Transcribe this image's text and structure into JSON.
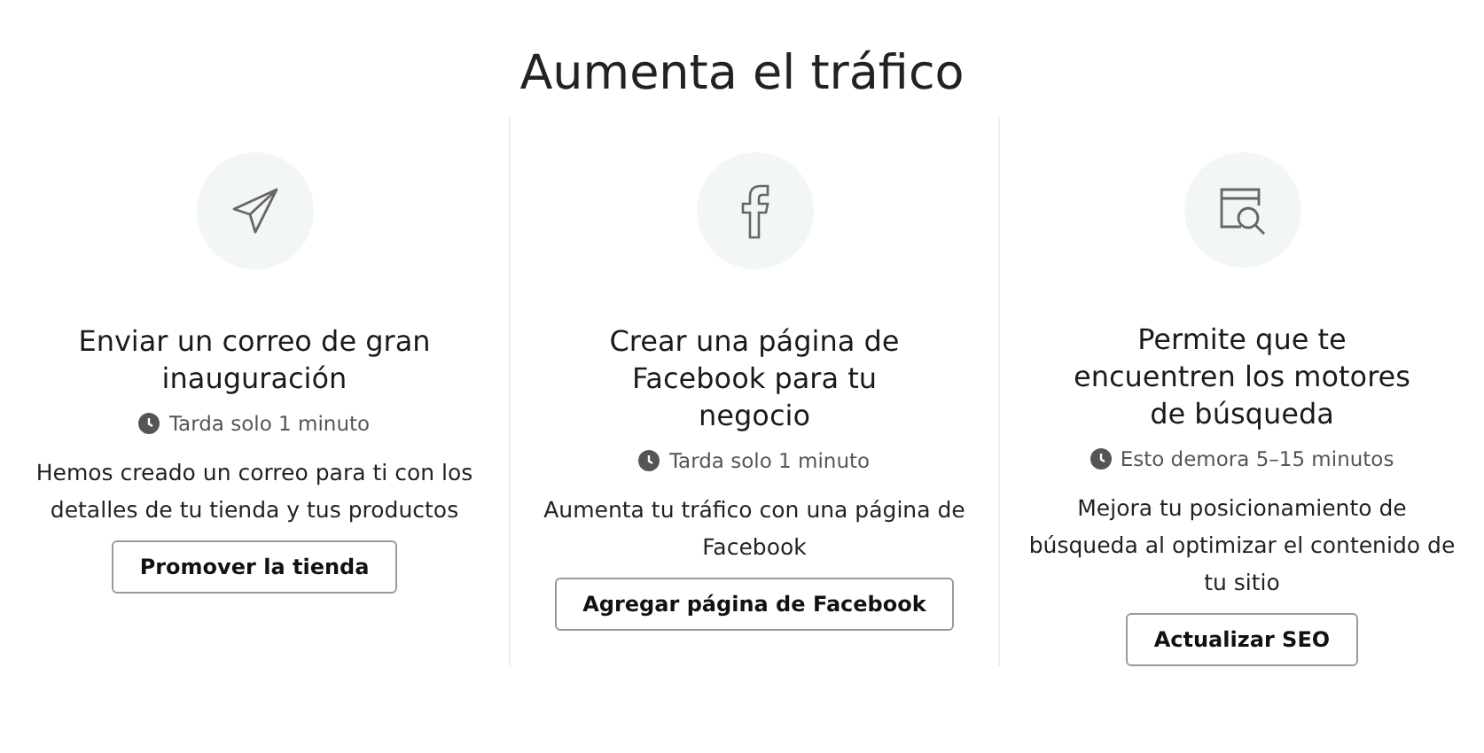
{
  "heading": "Aumenta el tráfico",
  "cards": [
    {
      "kind": "plane",
      "title": "Enviar un correo de gran inauguración",
      "time": "Tarda solo 1 minuto",
      "description": "Hemos creado un correo para ti con los detalles de tu tienda y tus productos",
      "button": "Promover la tienda"
    },
    {
      "kind": "facebook",
      "title": "Crear una página de Facebook para tu negocio",
      "time": "Tarda solo 1 minuto",
      "description": "Aumenta tu tráfico con una página de Facebook",
      "button": "Agregar página de Facebook"
    },
    {
      "kind": "seo",
      "title": "Permite que te encuentren los motores de búsqueda",
      "time": "Esto demora 5–15 minutos",
      "description": "Mejora tu posicionamiento de búsqueda al optimizar el contenido de tu sitio",
      "button": "Actualizar SEO"
    }
  ]
}
